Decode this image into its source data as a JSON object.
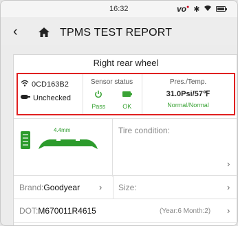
{
  "status_bar": {
    "time": "16:32",
    "carrier_icon": "volte-icon",
    "icons": [
      "bluetooth-icon",
      "wifi-icon",
      "battery-icon"
    ]
  },
  "header": {
    "title": "TPMS TEST REPORT"
  },
  "wheel": {
    "title": "Right rear wheel"
  },
  "sensor": {
    "id": "0CD163B2",
    "state": "Unchecked",
    "status_header": "Sensor status",
    "power_label": "Pass",
    "battery_label": "OK",
    "pt_header": "Pres./Temp.",
    "pt_value": "31.0Psi/57℉",
    "pt_state": "Normal/Normal"
  },
  "tire": {
    "tread_depth": "4.4mm",
    "condition_label": "Tire condition:"
  },
  "brand": {
    "label": "Brand:",
    "value": "Goodyear"
  },
  "size": {
    "label": "Size:"
  },
  "dot": {
    "label": "DOT:",
    "value": "M670011R4615",
    "date": "(Year:6 Month:2)"
  },
  "colors": {
    "alert_border": "#e02020",
    "ok_green": "#3aa335",
    "tread_green": "#2c9b2c"
  }
}
